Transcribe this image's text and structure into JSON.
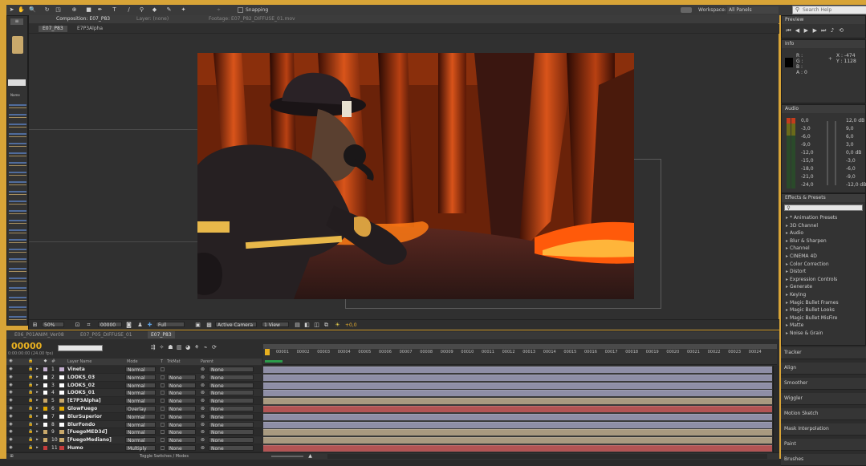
{
  "toolbar": {
    "snapping_label": "Snapping",
    "workspace_label": "Workspace:",
    "workspace_value": "All Panels",
    "search_placeholder": "Search Help"
  },
  "viewer": {
    "tabs": [
      "Composition: E07_P83",
      "Layer: (none)",
      "Footage: E07_P82_DIFFUSE_01.mov"
    ],
    "breadcrumb": [
      "E07_P83",
      "E7P3Alpha"
    ],
    "zoom": "50%",
    "timecode": "00000",
    "resolution": "Full",
    "camera": "Active Camera",
    "view": "1 View",
    "exposure": "+0,0"
  },
  "project_panel": {
    "name_header": "Name"
  },
  "preview": {
    "title": "Preview"
  },
  "info": {
    "title": "Info",
    "r": "R :",
    "g": "G :",
    "b": "B :",
    "a": "A : 0",
    "x": "X : -474",
    "y": "Y : 1128"
  },
  "audio": {
    "title": "Audio",
    "left_scale": [
      "0,0",
      "-3,0",
      "-6,0",
      "-9,0",
      "-12,0",
      "-15,0",
      "-18,0",
      "-21,0",
      "-24,0"
    ],
    "right_scale": [
      "12,0 dB",
      "9,0",
      "6,0",
      "3,0",
      "0,0 dB",
      "-3,0",
      "-6,0",
      "-9,0",
      "-12,0 dB"
    ]
  },
  "effects": {
    "title": "Effects & Presets",
    "items": [
      "* Animation Presets",
      "3D Channel",
      "Audio",
      "Blur & Sharpen",
      "Channel",
      "CINEMA 4D",
      "Color Correction",
      "Distort",
      "Expression Controls",
      "Generate",
      "Keying",
      "Magic Bullet Frames",
      "Magic Bullet Looks",
      "Magic Bullet MisFire",
      "Matte",
      "Noise & Grain"
    ]
  },
  "collapsed_panels": [
    "Tracker",
    "Align",
    "Smoother",
    "Wiggler",
    "Motion Sketch",
    "Mask Interpolation",
    "Paint",
    "Brushes"
  ],
  "timeline": {
    "tabs": [
      "E06_P01ANIM_Ver08",
      "E07_P05_DIFFUSE_01",
      "E07_P83"
    ],
    "timecode": "00000",
    "fps": "0:00:00:00 (24.00 fps)",
    "headers": {
      "num": "#",
      "layer_name": "Layer Name",
      "mode": "Mode",
      "t": "T",
      "trkmat": "TrkMat",
      "parent": "Parent"
    },
    "ruler": [
      "00001",
      "00002",
      "00003",
      "00004",
      "00005",
      "00006",
      "00007",
      "00008",
      "00009",
      "00010",
      "00011",
      "00012",
      "00013",
      "00014",
      "00015",
      "00016",
      "00017",
      "00018",
      "00019",
      "00020",
      "00021",
      "00022",
      "00023",
      "00024"
    ],
    "layers": [
      {
        "num": "1",
        "name": "Vineta",
        "mode": "Normal",
        "trkmat": "",
        "parent": "None",
        "label": "#c4b0d0",
        "bar": "#8e8ea6"
      },
      {
        "num": "2",
        "name": "LOOKS_03",
        "mode": "Normal",
        "trkmat": "None",
        "parent": "None",
        "label": "#ffffff",
        "bar": "#8e8ea6"
      },
      {
        "num": "3",
        "name": "LOOKS_02",
        "mode": "Normal",
        "trkmat": "None",
        "parent": "None",
        "label": "#ffffff",
        "bar": "#8e8ea6"
      },
      {
        "num": "4",
        "name": "LOOKS_01",
        "mode": "Normal",
        "trkmat": "None",
        "parent": "None",
        "label": "#ffffff",
        "bar": "#8e8ea6"
      },
      {
        "num": "5",
        "name": "[E7P3Alpha]",
        "mode": "Normal",
        "trkmat": "None",
        "parent": "None",
        "label": "#c9a96b",
        "bar": "#a99a80"
      },
      {
        "num": "6",
        "name": "GlowFuego",
        "mode": "Overlay",
        "trkmat": "None",
        "parent": "None",
        "label": "#e2a800",
        "bar": "#b35454"
      },
      {
        "num": "7",
        "name": "BlurSuperior",
        "mode": "Normal",
        "trkmat": "None",
        "parent": "None",
        "label": "#ffffff",
        "bar": "#8e8ea6"
      },
      {
        "num": "8",
        "name": "BlurFondo",
        "mode": "Normal",
        "trkmat": "None",
        "parent": "None",
        "label": "#ffffff",
        "bar": "#8e8ea6"
      },
      {
        "num": "9",
        "name": "[FuegoMED3d]",
        "mode": "Normal",
        "trkmat": "None",
        "parent": "None",
        "label": "#c9a96b",
        "bar": "#a99a80"
      },
      {
        "num": "10",
        "name": "[FuegoMediano]",
        "mode": "Normal",
        "trkmat": "None",
        "parent": "None",
        "label": "#c9a96b",
        "bar": "#a99a80"
      },
      {
        "num": "11",
        "name": "Humo",
        "mode": "Multiply",
        "trkmat": "None",
        "parent": "None",
        "label": "#c43c3c",
        "bar": "#b35454"
      }
    ],
    "toggle_label": "Toggle Switches / Modes"
  }
}
